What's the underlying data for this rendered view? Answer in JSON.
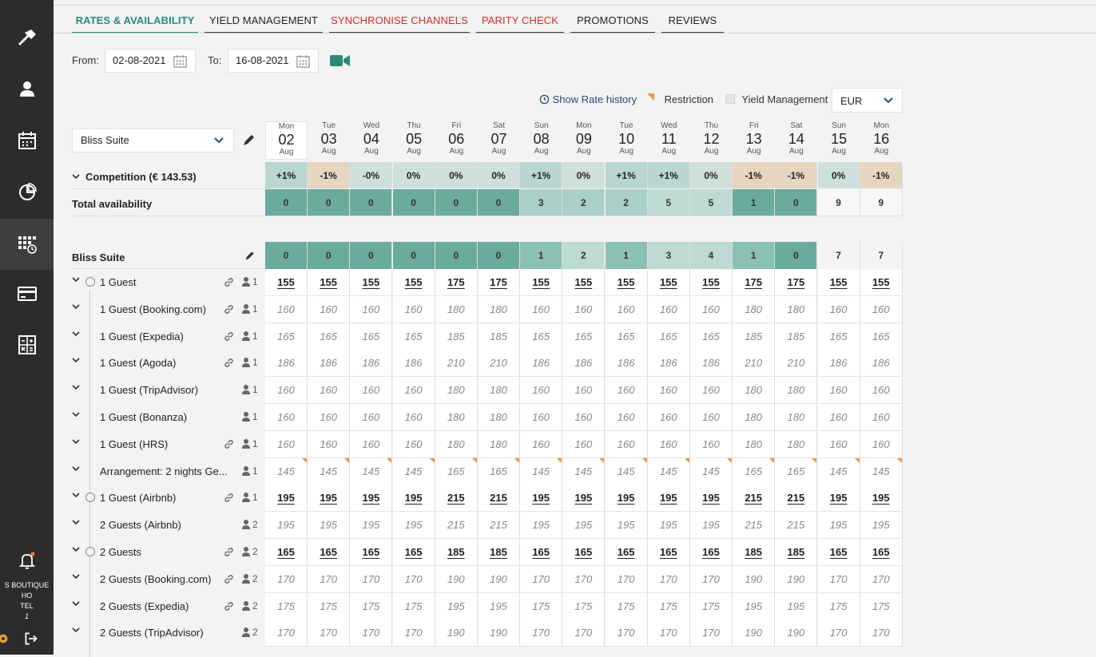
{
  "sidebar": {
    "hotel_name_line1": "S BOUTIQUE HO",
    "hotel_name_line2": "TEL",
    "hotel_name_line3": "1",
    "icons": [
      "wrench-icon",
      "user-icon",
      "calendar-icon",
      "pie-chart-icon",
      "grid-calendar-icon",
      "credit-card-icon",
      "calculator-icon",
      "bell-icon",
      "gear-icon",
      "logout-icon"
    ]
  },
  "tabs": [
    {
      "label": "RATES & AVAILABILITY",
      "state": "active"
    },
    {
      "label": "YIELD MANAGEMENT",
      "state": "normal"
    },
    {
      "label": "SYNCHRONISE CHANNELS",
      "state": "warning"
    },
    {
      "label": "PARITY CHECK",
      "state": "warning"
    },
    {
      "label": "PROMOTIONS",
      "state": "normal"
    },
    {
      "label": "REVIEWS",
      "state": "normal"
    }
  ],
  "filters": {
    "from_label": "From:",
    "from_value": "02-08-2021",
    "to_label": "To:",
    "to_value": "16-08-2021"
  },
  "legend": {
    "rate_history": "Show Rate history",
    "restriction": "Restriction",
    "yield_management": "Yield Management",
    "currency": "EUR"
  },
  "room_select": {
    "value": "Bliss Suite"
  },
  "days": [
    {
      "dow": "Mon",
      "day": "02",
      "mon": "Aug"
    },
    {
      "dow": "Tue",
      "day": "03",
      "mon": "Aug"
    },
    {
      "dow": "Wed",
      "day": "04",
      "mon": "Aug"
    },
    {
      "dow": "Thu",
      "day": "05",
      "mon": "Aug"
    },
    {
      "dow": "Fri",
      "day": "06",
      "mon": "Aug"
    },
    {
      "dow": "Sat",
      "day": "07",
      "mon": "Aug"
    },
    {
      "dow": "Sun",
      "day": "08",
      "mon": "Aug"
    },
    {
      "dow": "Mon",
      "day": "09",
      "mon": "Aug"
    },
    {
      "dow": "Tue",
      "day": "10",
      "mon": "Aug"
    },
    {
      "dow": "Wed",
      "day": "11",
      "mon": "Aug"
    },
    {
      "dow": "Thu",
      "day": "12",
      "mon": "Aug"
    },
    {
      "dow": "Fri",
      "day": "13",
      "mon": "Aug"
    },
    {
      "dow": "Sat",
      "day": "14",
      "mon": "Aug"
    },
    {
      "dow": "Sun",
      "day": "15",
      "mon": "Aug"
    },
    {
      "dow": "Mon",
      "day": "16",
      "mon": "Aug"
    }
  ],
  "competition": {
    "label": "Competition (€ 143.53)",
    "values": [
      "+1%",
      "-1%",
      "-0%",
      "0%",
      "0%",
      "0%",
      "+1%",
      "0%",
      "+1%",
      "+1%",
      "0%",
      "-1%",
      "-1%",
      "0%",
      "-1%"
    ]
  },
  "total_availability": {
    "label": "Total availability",
    "values": [
      "0",
      "0",
      "0",
      "0",
      "0",
      "0",
      "3",
      "2",
      "2",
      "5",
      "5",
      "1",
      "0",
      "9",
      "9"
    ]
  },
  "room": {
    "name": "Bliss Suite",
    "availability": [
      "0",
      "0",
      "0",
      "0",
      "0",
      "0",
      "1",
      "2",
      "1",
      "3",
      "4",
      "1",
      "0",
      "7",
      "7"
    ]
  },
  "rates": [
    {
      "label": "1 Guest",
      "main": true,
      "link": true,
      "occ": "1",
      "values": [
        "155",
        "155",
        "155",
        "155",
        "175",
        "175",
        "155",
        "155",
        "155",
        "155",
        "155",
        "175",
        "175",
        "155",
        "155"
      ]
    },
    {
      "label": "1 Guest (Booking.com)",
      "main": false,
      "link": true,
      "occ": "1",
      "values": [
        "160",
        "160",
        "160",
        "160",
        "180",
        "180",
        "160",
        "160",
        "160",
        "160",
        "160",
        "180",
        "180",
        "160",
        "160"
      ]
    },
    {
      "label": "1 Guest (Expedia)",
      "main": false,
      "link": true,
      "occ": "1",
      "values": [
        "165",
        "165",
        "165",
        "165",
        "185",
        "185",
        "165",
        "165",
        "165",
        "165",
        "165",
        "185",
        "185",
        "165",
        "165"
      ]
    },
    {
      "label": "1 Guest (Agoda)",
      "main": false,
      "link": true,
      "occ": "1",
      "values": [
        "186",
        "186",
        "186",
        "186",
        "210",
        "210",
        "186",
        "186",
        "186",
        "186",
        "186",
        "210",
        "210",
        "186",
        "186"
      ]
    },
    {
      "label": "1 Guest (TripAdvisor)",
      "main": false,
      "link": false,
      "occ": "1",
      "values": [
        "160",
        "160",
        "160",
        "160",
        "180",
        "180",
        "160",
        "160",
        "160",
        "160",
        "160",
        "180",
        "180",
        "160",
        "160"
      ]
    },
    {
      "label": "1 Guest (Bonanza)",
      "main": false,
      "link": false,
      "occ": "1",
      "values": [
        "160",
        "160",
        "160",
        "160",
        "180",
        "180",
        "160",
        "160",
        "160",
        "160",
        "160",
        "180",
        "180",
        "160",
        "160"
      ]
    },
    {
      "label": "1 Guest (HRS)",
      "main": false,
      "link": true,
      "occ": "1",
      "values": [
        "160",
        "160",
        "160",
        "160",
        "180",
        "180",
        "160",
        "160",
        "160",
        "160",
        "160",
        "180",
        "180",
        "160",
        "160"
      ]
    },
    {
      "label": "Arrangement: 2 nights Ge...",
      "main": false,
      "link": false,
      "occ": "1",
      "restriction": true,
      "values": [
        "145",
        "145",
        "145",
        "145",
        "165",
        "165",
        "145",
        "145",
        "145",
        "145",
        "145",
        "165",
        "165",
        "145",
        "145"
      ]
    },
    {
      "label": "1 Guest (Airbnb)",
      "main": true,
      "link": true,
      "occ": "1",
      "values": [
        "195",
        "195",
        "195",
        "195",
        "215",
        "215",
        "195",
        "195",
        "195",
        "195",
        "195",
        "215",
        "215",
        "195",
        "195"
      ]
    },
    {
      "label": "2 Guests (Airbnb)",
      "main": false,
      "link": false,
      "occ": "2",
      "values": [
        "195",
        "195",
        "195",
        "195",
        "215",
        "215",
        "195",
        "195",
        "195",
        "195",
        "195",
        "215",
        "215",
        "195",
        "195"
      ]
    },
    {
      "label": "2 Guests",
      "main": true,
      "link": true,
      "occ": "2",
      "values": [
        "165",
        "165",
        "165",
        "165",
        "185",
        "185",
        "165",
        "165",
        "165",
        "165",
        "165",
        "185",
        "185",
        "165",
        "165"
      ]
    },
    {
      "label": "2 Guests (Booking.com)",
      "main": false,
      "link": true,
      "occ": "2",
      "values": [
        "170",
        "170",
        "170",
        "170",
        "190",
        "190",
        "170",
        "170",
        "170",
        "170",
        "170",
        "190",
        "190",
        "170",
        "170"
      ]
    },
    {
      "label": "2 Guests (Expedia)",
      "main": false,
      "link": true,
      "occ": "2",
      "values": [
        "175",
        "175",
        "175",
        "175",
        "195",
        "195",
        "175",
        "175",
        "175",
        "175",
        "175",
        "195",
        "195",
        "175",
        "175"
      ]
    },
    {
      "label": "2 Guests (TripAdvisor)",
      "main": false,
      "link": false,
      "occ": "2",
      "values": [
        "170",
        "170",
        "170",
        "170",
        "190",
        "190",
        "170",
        "170",
        "170",
        "170",
        "170",
        "190",
        "190",
        "170",
        "170"
      ]
    }
  ],
  "colors": {
    "accent": "#2a8a78",
    "warning": "#d62b2b",
    "restriction": "#f0963a",
    "avail_zero": "#6aab9e",
    "avail_low": "#8bc0b5",
    "avail_mid": "#a9cfc6",
    "avail_high": "#bddad3",
    "comp_plus": "#b9d6d0",
    "comp_minus": "#e6d5c1",
    "comp_zero": "#cfe0dc"
  }
}
